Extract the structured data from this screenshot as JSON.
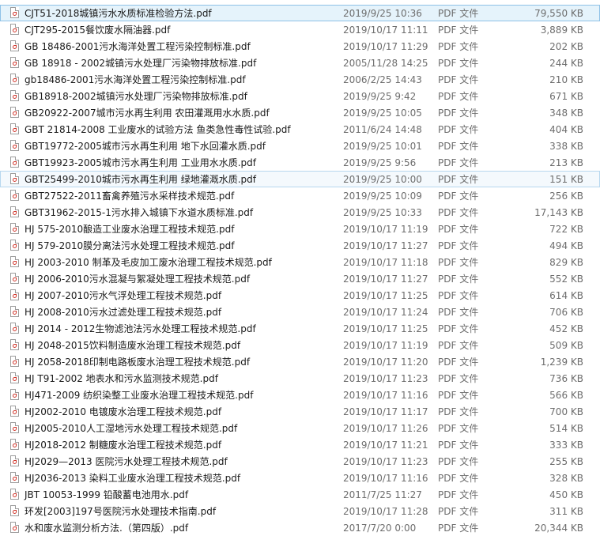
{
  "files": [
    {
      "name": "CJT51-2018城镇污水水质标准检验方法.pdf",
      "date": "2019/9/25 10:36",
      "type": "PDF 文件",
      "size": "79,550 KB",
      "state": "selected"
    },
    {
      "name": "CJT295-2015餐饮废水隔油器.pdf",
      "date": "2019/10/17 11:11",
      "type": "PDF 文件",
      "size": "3,889 KB",
      "state": ""
    },
    {
      "name": "GB 18486-2001污水海洋处置工程污染控制标准.pdf",
      "date": "2019/10/17 11:29",
      "type": "PDF 文件",
      "size": "202 KB",
      "state": ""
    },
    {
      "name": "GB 18918 - 2002城镇污水处理厂污染物排放标准.pdf",
      "date": "2005/11/28 14:25",
      "type": "PDF 文件",
      "size": "244 KB",
      "state": ""
    },
    {
      "name": "gb18486-2001污水海洋处置工程污染控制标准.pdf",
      "date": "2006/2/25 14:43",
      "type": "PDF 文件",
      "size": "210 KB",
      "state": ""
    },
    {
      "name": "GB18918-2002城镇污水处理厂污染物排放标准.pdf",
      "date": "2019/9/25 9:42",
      "type": "PDF 文件",
      "size": "671 KB",
      "state": ""
    },
    {
      "name": "GB20922-2007城市污水再生利用 农田灌溉用水水质.pdf",
      "date": "2019/9/25 10:05",
      "type": "PDF 文件",
      "size": "348 KB",
      "state": ""
    },
    {
      "name": "GBT 21814-2008 工业废水的试验方法 鱼类急性毒性试验.pdf",
      "date": "2011/6/24 14:48",
      "type": "PDF 文件",
      "size": "404 KB",
      "state": ""
    },
    {
      "name": "GBT19772-2005城市污水再生利用 地下水回灌水质.pdf",
      "date": "2019/9/25 10:01",
      "type": "PDF 文件",
      "size": "338 KB",
      "state": ""
    },
    {
      "name": "GBT19923-2005城市污水再生利用 工业用水水质.pdf",
      "date": "2019/9/25 9:56",
      "type": "PDF 文件",
      "size": "213 KB",
      "state": ""
    },
    {
      "name": "GBT25499-2010城市污水再生利用 绿地灌溉水质.pdf",
      "date": "2019/9/25 10:00",
      "type": "PDF 文件",
      "size": "151 KB",
      "state": "hover"
    },
    {
      "name": "GBT27522-2011畜禽养殖污水采样技术规范.pdf",
      "date": "2019/9/25 10:09",
      "type": "PDF 文件",
      "size": "256 KB",
      "state": ""
    },
    {
      "name": "GBT31962-2015-1污水排入城镇下水道水质标准.pdf",
      "date": "2019/9/25 10:33",
      "type": "PDF 文件",
      "size": "17,143 KB",
      "state": ""
    },
    {
      "name": "HJ 575-2010酿造工业废水治理工程技术规范.pdf",
      "date": "2019/10/17 11:19",
      "type": "PDF 文件",
      "size": "722 KB",
      "state": ""
    },
    {
      "name": "HJ 579-2010膜分离法污水处理工程技术规范.pdf",
      "date": "2019/10/17 11:27",
      "type": "PDF 文件",
      "size": "494 KB",
      "state": ""
    },
    {
      "name": "HJ 2003-2010 制革及毛皮加工废水治理工程技术规范.pdf",
      "date": "2019/10/17 11:18",
      "type": "PDF 文件",
      "size": "829 KB",
      "state": ""
    },
    {
      "name": "HJ 2006-2010污水混凝与絮凝处理工程技术规范.pdf",
      "date": "2019/10/17 11:27",
      "type": "PDF 文件",
      "size": "552 KB",
      "state": ""
    },
    {
      "name": "HJ 2007-2010污水气浮处理工程技术规范.pdf",
      "date": "2019/10/17 11:25",
      "type": "PDF 文件",
      "size": "614 KB",
      "state": ""
    },
    {
      "name": "HJ 2008-2010污水过滤处理工程技术规范.pdf",
      "date": "2019/10/17 11:24",
      "type": "PDF 文件",
      "size": "706 KB",
      "state": ""
    },
    {
      "name": "HJ 2014 - 2012生物滤池法污水处理工程技术规范.pdf",
      "date": "2019/10/17 11:25",
      "type": "PDF 文件",
      "size": "452 KB",
      "state": ""
    },
    {
      "name": "HJ 2048-2015饮料制造废水治理工程技术规范.pdf",
      "date": "2019/10/17 11:19",
      "type": "PDF 文件",
      "size": "509 KB",
      "state": ""
    },
    {
      "name": "HJ 2058-2018印制电路板废水治理工程技术规范.pdf",
      "date": "2019/10/17 11:20",
      "type": "PDF 文件",
      "size": "1,239 KB",
      "state": ""
    },
    {
      "name": "HJ T91-2002 地表水和污水监测技术规范.pdf",
      "date": "2019/10/17 11:23",
      "type": "PDF 文件",
      "size": "736 KB",
      "state": ""
    },
    {
      "name": "HJ471-2009 纺织染整工业废水治理工程技术规范.pdf",
      "date": "2019/10/17 11:16",
      "type": "PDF 文件",
      "size": "566 KB",
      "state": ""
    },
    {
      "name": "HJ2002-2010 电镀废水治理工程技术规范.pdf",
      "date": "2019/10/17 11:17",
      "type": "PDF 文件",
      "size": "700 KB",
      "state": ""
    },
    {
      "name": "HJ2005-2010人工湿地污水处理工程技术规范.pdf",
      "date": "2019/10/17 11:26",
      "type": "PDF 文件",
      "size": "514 KB",
      "state": ""
    },
    {
      "name": "HJ2018-2012 制糖废水治理工程技术规范.pdf",
      "date": "2019/10/17 11:21",
      "type": "PDF 文件",
      "size": "333 KB",
      "state": ""
    },
    {
      "name": "HJ2029—2013 医院污水处理工程技术规范.pdf",
      "date": "2019/10/17 11:23",
      "type": "PDF 文件",
      "size": "255 KB",
      "state": ""
    },
    {
      "name": "HJ2036-2013 染料工业废水治理工程技术规范.pdf",
      "date": "2019/10/17 11:16",
      "type": "PDF 文件",
      "size": "328 KB",
      "state": ""
    },
    {
      "name": "JBT 10053-1999 铅酸蓄电池用水.pdf",
      "date": "2011/7/25 11:27",
      "type": "PDF 文件",
      "size": "450 KB",
      "state": ""
    },
    {
      "name": "环发[2003]197号医院污水处理技术指南.pdf",
      "date": "2019/10/17 11:28",
      "type": "PDF 文件",
      "size": "311 KB",
      "state": ""
    },
    {
      "name": "水和废水监测分析方法.（第四版）.pdf",
      "date": "2017/7/20 0:00",
      "type": "PDF 文件",
      "size": "20,344 KB",
      "state": ""
    }
  ]
}
